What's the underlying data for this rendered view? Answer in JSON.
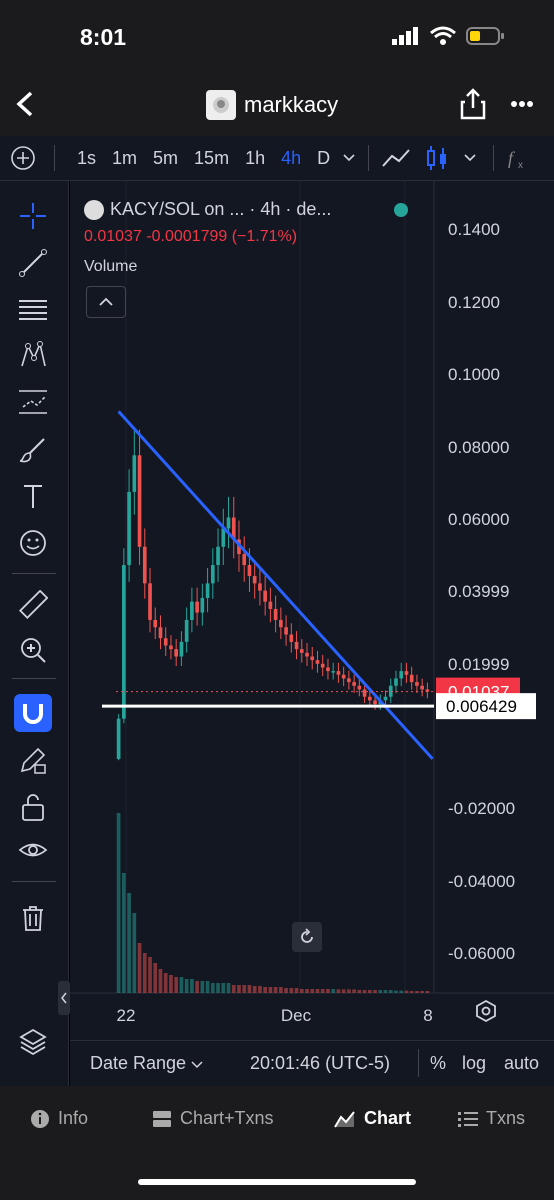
{
  "status": {
    "time": "8:01"
  },
  "header": {
    "title": "markkacy"
  },
  "timeframes": [
    "1s",
    "1m",
    "5m",
    "15m",
    "1h",
    "4h",
    "D"
  ],
  "active_timeframe": "4h",
  "legend": {
    "title": "KACY/SOL on ... · 4h · de...",
    "last": "0.01037",
    "change": "-0.0001799",
    "change_pct": "(−1.71%)",
    "volume_label": "Volume"
  },
  "price_axis": {
    "labels": [
      "0.1400",
      "0.1200",
      "0.1000",
      "0.08000",
      "0.06000",
      "0.03999",
      "0.01999",
      "-0.02000",
      "-0.04000",
      "-0.06000"
    ],
    "last_price_tag": "0.01037",
    "line_price_tag": "0.006429"
  },
  "time_axis": {
    "labels": [
      "22",
      "Dec",
      "8"
    ]
  },
  "bottom": {
    "date_range": "Date Range",
    "clock": "20:01:46 (UTC-5)",
    "percent": "%",
    "log": "log",
    "auto": "auto"
  },
  "tabs": [
    {
      "label": "Info",
      "icon": "info-icon"
    },
    {
      "label": "Chart+Txns",
      "icon": "split-icon"
    },
    {
      "label": "Chart",
      "icon": "chart-icon"
    },
    {
      "label": "Txns",
      "icon": "list-icon"
    }
  ],
  "colors": {
    "up": "#26a69a",
    "down": "#ef5350",
    "accent": "#2962ff",
    "bg": "#131722"
  },
  "chart_data": {
    "type": "candlestick",
    "ylim": [
      -0.072,
      0.15
    ],
    "close": [
      0.003,
      0.045,
      0.065,
      0.075,
      0.05,
      0.04,
      0.03,
      0.028,
      0.025,
      0.023,
      0.022,
      0.02,
      0.024,
      0.03,
      0.035,
      0.032,
      0.036,
      0.04,
      0.045,
      0.05,
      0.055,
      0.058,
      0.052,
      0.048,
      0.045,
      0.042,
      0.04,
      0.038,
      0.035,
      0.033,
      0.03,
      0.028,
      0.026,
      0.024,
      0.022,
      0.021,
      0.02,
      0.019,
      0.018,
      0.017,
      0.016,
      0.016,
      0.015,
      0.014,
      0.013,
      0.012,
      0.011,
      0.009,
      0.008,
      0.007,
      0.008,
      0.009,
      0.012,
      0.014,
      0.016,
      0.015,
      0.013,
      0.012,
      0.011,
      0.0104
    ],
    "volume": [
      0.9,
      0.6,
      0.5,
      0.4,
      0.25,
      0.2,
      0.18,
      0.15,
      0.12,
      0.1,
      0.09,
      0.08,
      0.08,
      0.07,
      0.07,
      0.06,
      0.06,
      0.06,
      0.05,
      0.05,
      0.05,
      0.05,
      0.04,
      0.04,
      0.04,
      0.04,
      0.035,
      0.035,
      0.03,
      0.03,
      0.03,
      0.03,
      0.025,
      0.025,
      0.025,
      0.02,
      0.02,
      0.02,
      0.02,
      0.02,
      0.02,
      0.02,
      0.018,
      0.018,
      0.018,
      0.018,
      0.015,
      0.015,
      0.015,
      0.015,
      0.015,
      0.015,
      0.015,
      0.012,
      0.012,
      0.012,
      0.01,
      0.01,
      0.01,
      0.01
    ],
    "trendline": {
      "from": [
        0,
        0.087
      ],
      "to": [
        60,
        -0.008
      ]
    },
    "support": 0.006429
  }
}
